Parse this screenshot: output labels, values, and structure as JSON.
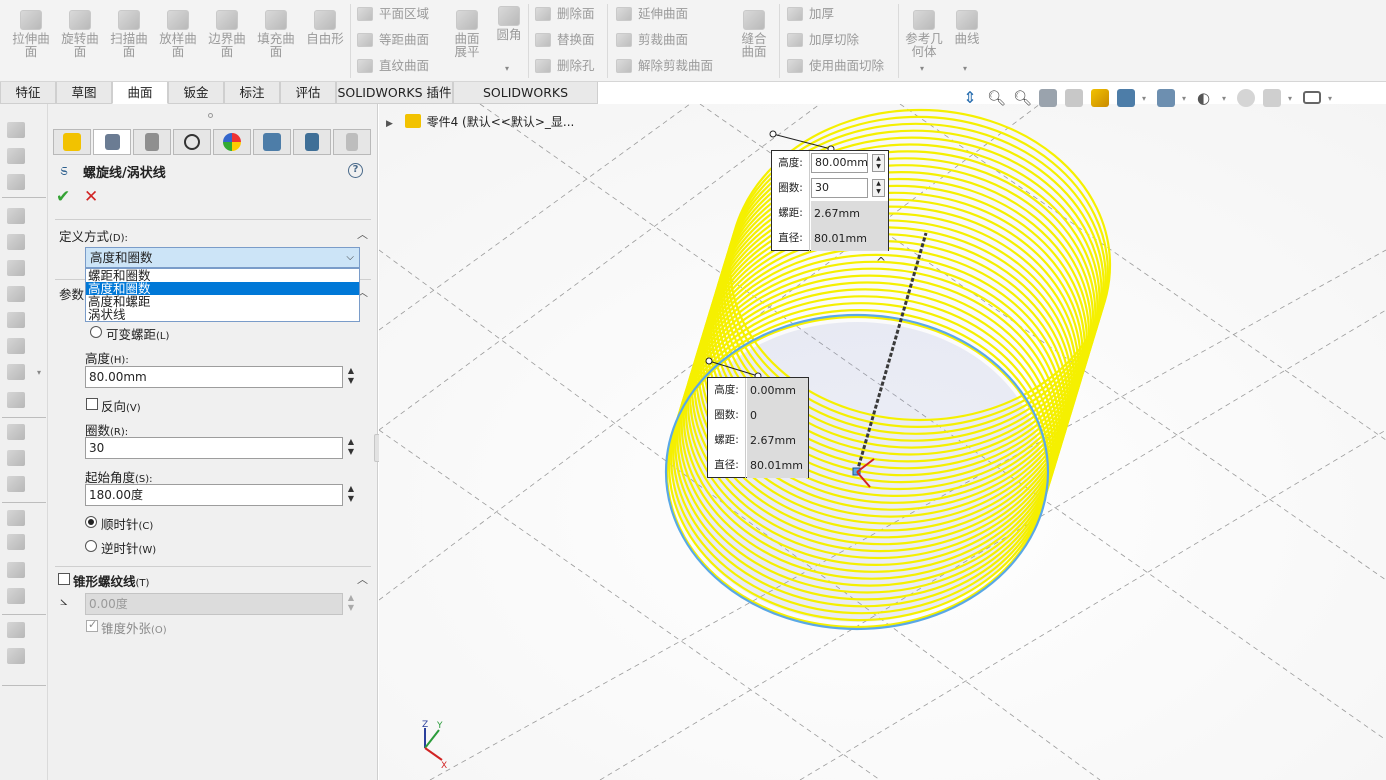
{
  "ribbon": {
    "big_buttons": [
      {
        "label": "拉伸曲面",
        "icon": "extruded-surface-icon"
      },
      {
        "label": "旋转曲面",
        "icon": "revolved-surface-icon"
      },
      {
        "label": "扫描曲面",
        "icon": "swept-surface-icon"
      },
      {
        "label": "放样曲面",
        "icon": "lofted-surface-icon"
      },
      {
        "label": "边界曲面",
        "icon": "boundary-surface-icon"
      },
      {
        "label": "填充曲面",
        "icon": "filled-surface-icon"
      },
      {
        "label": "自由形",
        "icon": "freeform-icon"
      }
    ],
    "group2": [
      "平面区域",
      "等距曲面",
      "直纹曲面"
    ],
    "surface_flatten": "曲面展平",
    "fillet": "圆角",
    "group3": [
      "删除面",
      "替换面",
      "删除孔"
    ],
    "group4": [
      "延伸曲面",
      "剪裁曲面",
      "解除剪裁曲面"
    ],
    "knit": "缝合曲面",
    "group5": [
      "加厚",
      "加厚切除",
      "使用曲面切除"
    ],
    "ref_geometry": "参考几何体",
    "curves": "曲线"
  },
  "tabs": [
    "特征",
    "草图",
    "曲面",
    "钣金",
    "标注",
    "评估",
    "SOLIDWORKS 插件",
    "SOLIDWORKS Inspection"
  ],
  "active_tab": "曲面",
  "feature": {
    "title": "螺旋线/涡状线",
    "help": "?",
    "ok_icon": "✔",
    "cancel_icon": "✕"
  },
  "definition": {
    "title": "定义方式",
    "shortcut": "(D):",
    "selected": "高度和圈数",
    "options": [
      "螺距和圈数",
      "高度和圈数",
      "高度和螺距",
      "涡状线"
    ],
    "selected_index": 1
  },
  "params": {
    "title_partial": "参数",
    "variable_pitch": "可变螺距",
    "variable_pitch_key": "(L)",
    "height_label": "高度",
    "height_key": "(H):",
    "height_value": "80.00mm",
    "reverse_label": "反向",
    "reverse_key": "(V)",
    "revolutions_label": "圈数",
    "revolutions_key": "(R):",
    "revolutions_value": "30",
    "start_angle_label": "起始角度",
    "start_angle_key": "(S):",
    "start_angle_value": "180.00度",
    "clockwise": "顺时针",
    "clockwise_key": "(C)",
    "counterclockwise": "逆时针",
    "counterclockwise_key": "(W)",
    "direction_selected": "clockwise"
  },
  "taper": {
    "title": "锥形螺纹线",
    "key": "(T)",
    "angle_value": "0.00度",
    "taper_outward": "锥度外张",
    "taper_outward_key": "(O)"
  },
  "tree": {
    "part_name": "零件4",
    "config": "(默认<<默认>_显..."
  },
  "callout_top": {
    "rows": [
      {
        "label": "高度:",
        "value": "80.00mm"
      },
      {
        "label": "圈数:",
        "value": "30"
      },
      {
        "label": "螺距:",
        "value": "2.67mm"
      },
      {
        "label": "直径:",
        "value": "80.01mm"
      }
    ]
  },
  "callout_bottom": {
    "rows": [
      {
        "label": "高度:",
        "value": "0.00mm"
      },
      {
        "label": "圈数:",
        "value": "0"
      },
      {
        "label": "螺距:",
        "value": "2.67mm"
      },
      {
        "label": "直径:",
        "value": "80.01mm"
      }
    ]
  },
  "triad": {
    "x": "X",
    "y": "Y",
    "z": "Z"
  },
  "colors": {
    "helix": "#f5f000",
    "base_circle": "#5aa8e6",
    "active_selection": "#0078d7",
    "ok_green": "#35a335",
    "cancel_red": "#d12424"
  }
}
